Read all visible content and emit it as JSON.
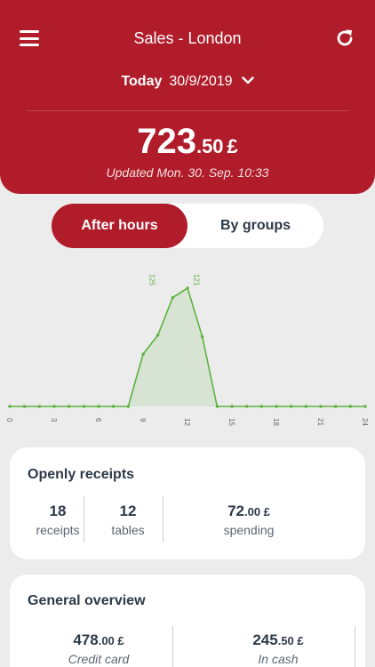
{
  "header": {
    "title": "Sales - London",
    "date_label": "Today",
    "date_value": "30/9/2019",
    "amount_int": "723",
    "amount_dec": ".50",
    "currency": "£",
    "updated": "Updated Mon. 30. Sep. 10:33"
  },
  "tabs": {
    "active": "After hours",
    "inactive": "By groups"
  },
  "chart_data": {
    "type": "area",
    "x": [
      0,
      1,
      2,
      3,
      4,
      5,
      6,
      7,
      8,
      9,
      10,
      11,
      12,
      13,
      14,
      15,
      16,
      17,
      18,
      19,
      20,
      21,
      22,
      23,
      24
    ],
    "values": [
      0,
      0,
      0,
      0,
      0,
      0,
      0,
      0,
      0,
      60,
      82,
      125,
      136,
      80,
      0,
      0,
      0,
      0,
      0,
      0,
      0,
      0,
      0,
      0,
      0
    ],
    "tick_labels": [
      "0",
      "3",
      "6",
      "9",
      "12",
      "15",
      "18",
      "21",
      "24"
    ],
    "annotations": [
      "125",
      "121"
    ],
    "color": "#5cb33e"
  },
  "card1": {
    "title": "Openly receipts",
    "stats": [
      {
        "value": "18",
        "label": "receipts"
      },
      {
        "value": "12",
        "label": "tables"
      },
      {
        "value": "72",
        "dec": ".00 £",
        "label": "spending"
      }
    ]
  },
  "card2": {
    "title": "General overview",
    "stats": [
      {
        "value": "478",
        "dec": ".00 £",
        "label": "Credit card"
      },
      {
        "value": "245",
        "dec": ".50 £",
        "label": "In cash"
      }
    ]
  },
  "colors": {
    "brand": "#b01c2a",
    "chart": "#5cb33e"
  }
}
